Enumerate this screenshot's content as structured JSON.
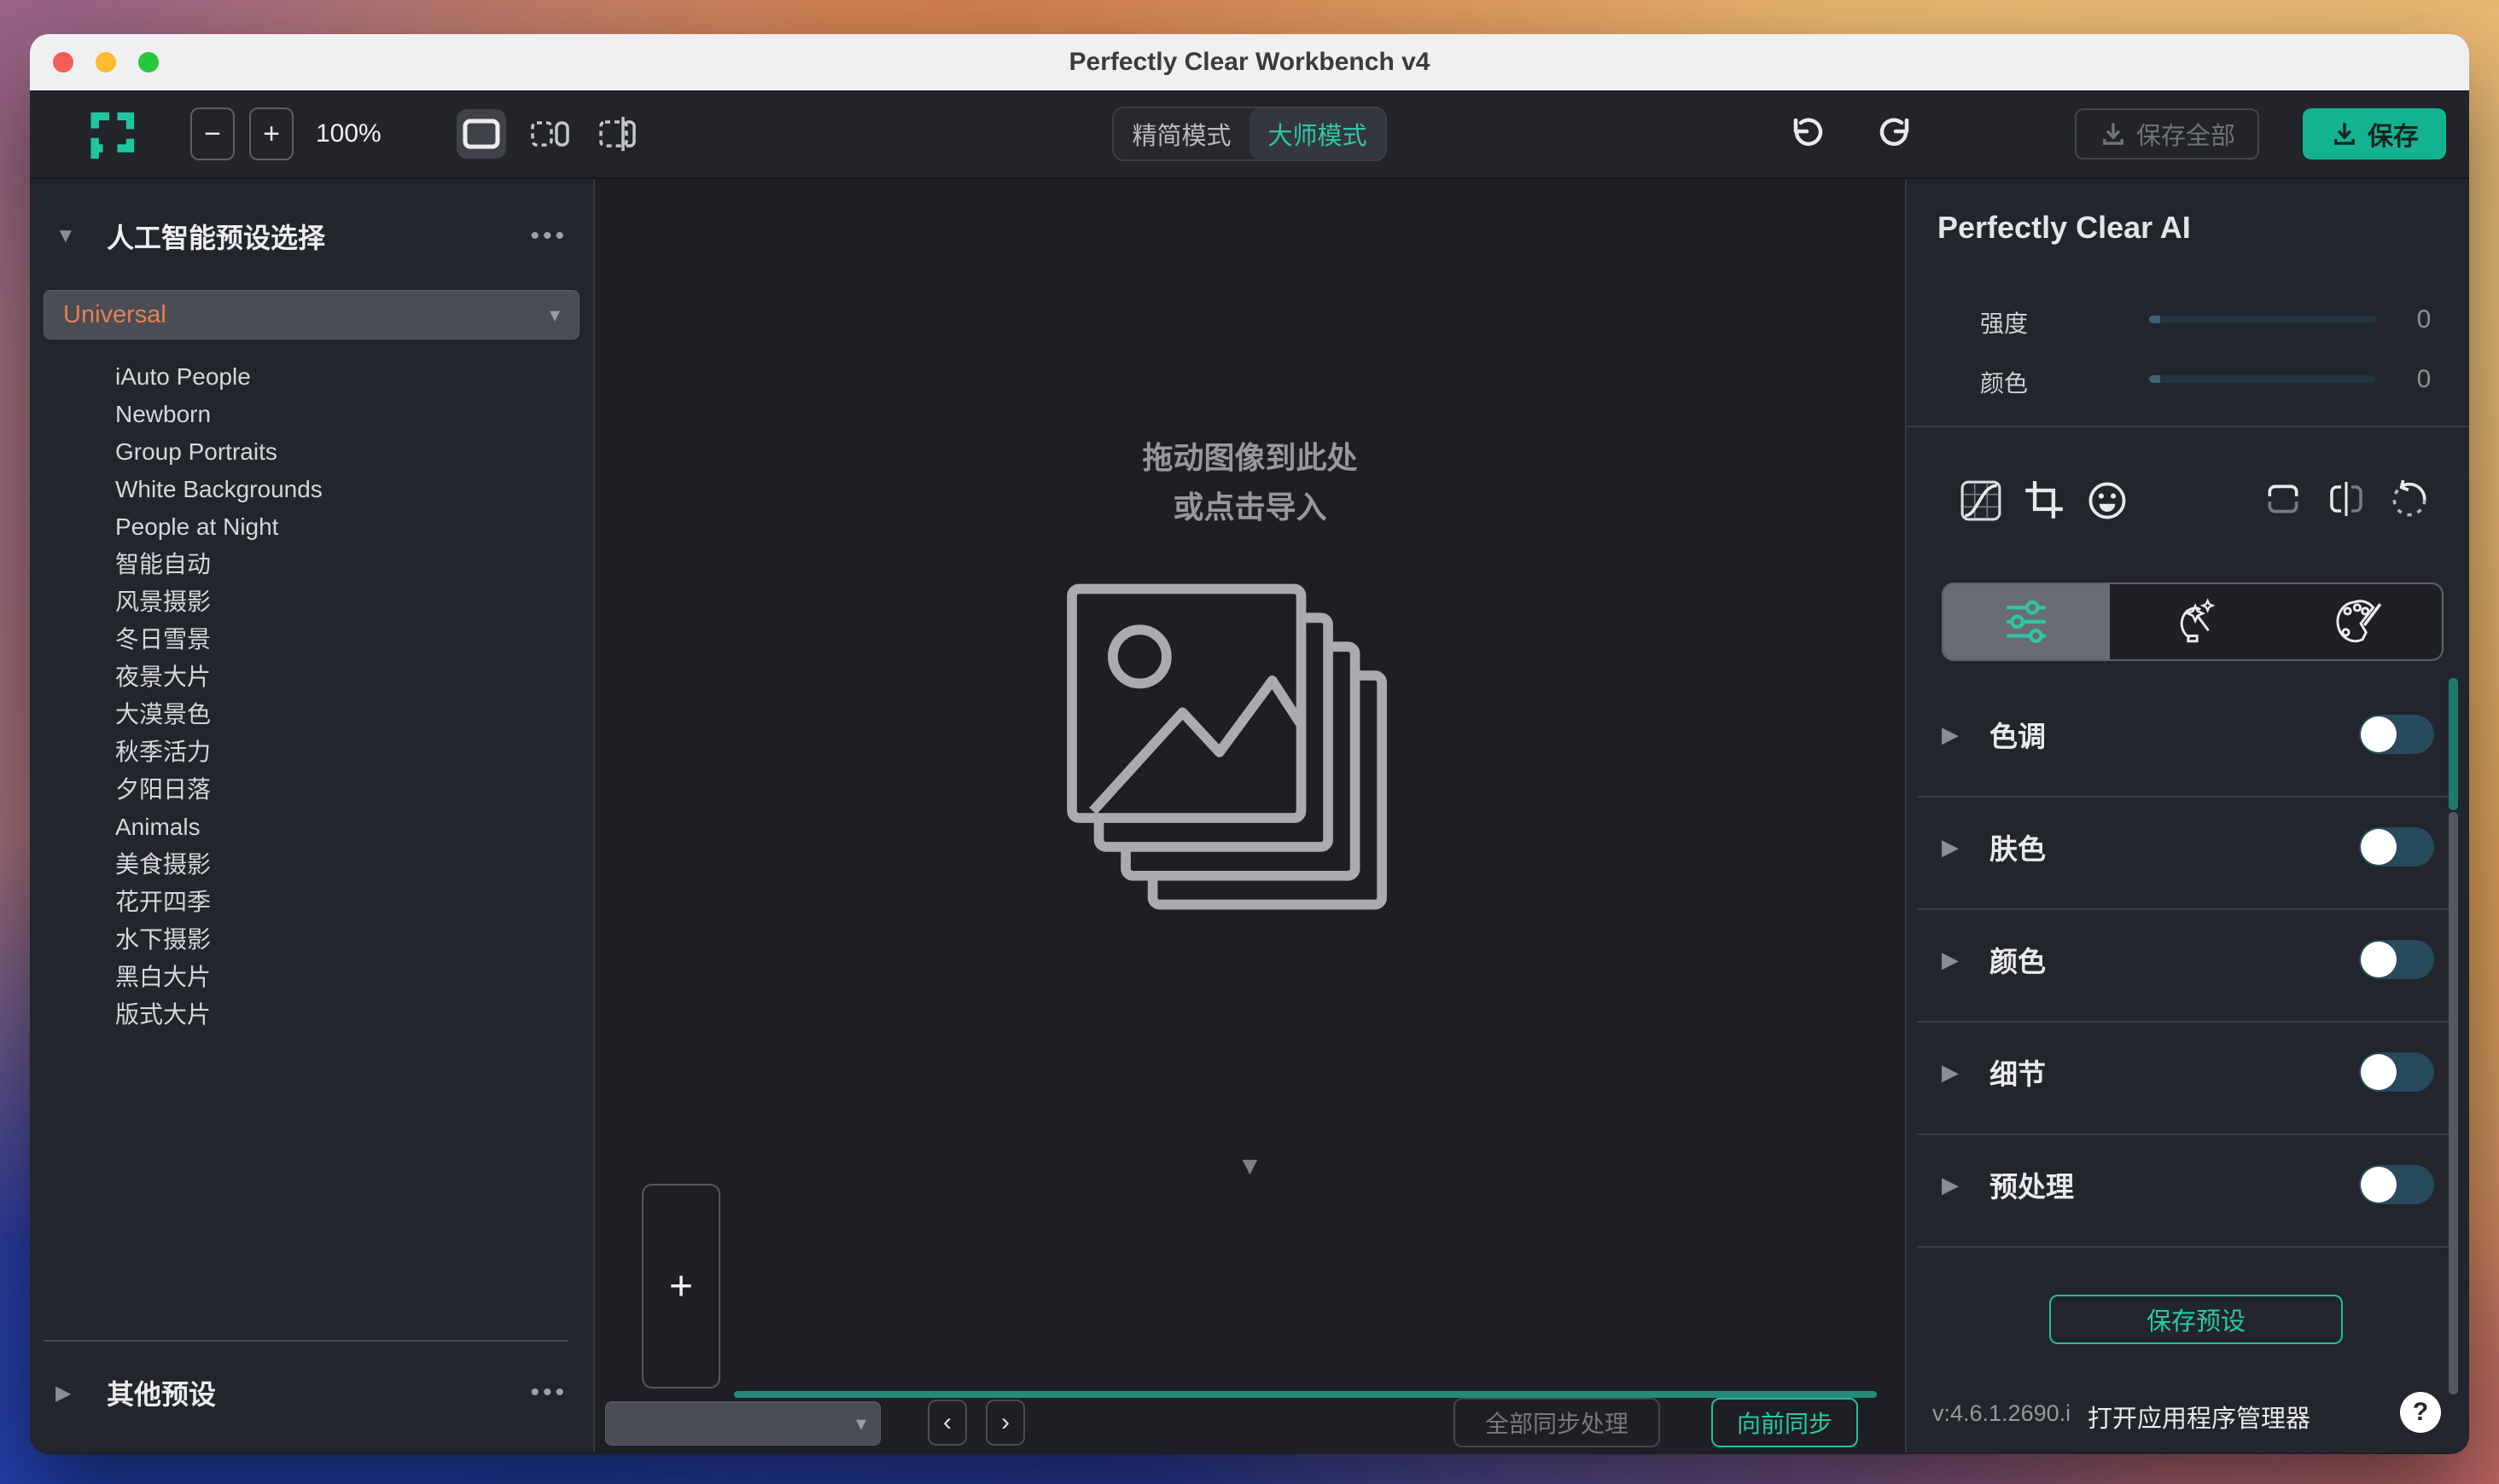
{
  "window": {
    "title": "Perfectly Clear Workbench v4"
  },
  "icons": {
    "minus": "−",
    "plus": "+",
    "dots": "•••",
    "caret": "▾",
    "collapse_arrow": "▼",
    "expand_arrow": "▶",
    "chevron_left": "‹",
    "chevron_right": "›",
    "help": "?",
    "filmstrip_collapse": "▼"
  },
  "toolbar": {
    "zoom_level": "100%",
    "mode_simple": "精简模式",
    "mode_master": "大师模式",
    "save_all_label": "保存全部",
    "save_label": "保存"
  },
  "sidebar": {
    "header": "人工智能预设选择",
    "preset_group": "Universal",
    "presets": [
      "iAuto People",
      "Newborn",
      "Group Portraits",
      "White Backgrounds",
      "People at Night",
      "智能自动",
      "风景摄影",
      "冬日雪景",
      "夜景大片",
      "大漠景色",
      "秋季活力",
      "夕阳日落",
      "Animals",
      "美食摄影",
      "花开四季",
      "水下摄影",
      "黑白大片",
      "版式大片"
    ],
    "other_presets": "其他预设"
  },
  "canvas": {
    "dropzone_line1": "拖动图像到此处",
    "dropzone_line2": "或点击导入",
    "add_button": "+"
  },
  "bottombar": {
    "image_select_value": "",
    "sync_all_label": "全部同步处理",
    "sync_forward_label": "向前同步"
  },
  "right_panel": {
    "title": "Perfectly Clear AI",
    "strength_label": "强度",
    "strength_value": "0",
    "color_label": "颜色",
    "color_value": "0",
    "sections": [
      "色调",
      "肤色",
      "颜色",
      "细节",
      "预处理"
    ],
    "save_preset_label": "保存预设",
    "version": "v:4.6.1.2690.i",
    "app_manager_label": "打开应用程序管理器"
  },
  "colors": {
    "accent_teal": "#2cc7a5",
    "save_button_bg": "#13b292",
    "preset_group_orange": "#e77f4f",
    "toggle_track": "#274a5c",
    "traffic_red": "#f25e57",
    "traffic_yellow": "#febc2e",
    "traffic_green": "#28c73f"
  }
}
